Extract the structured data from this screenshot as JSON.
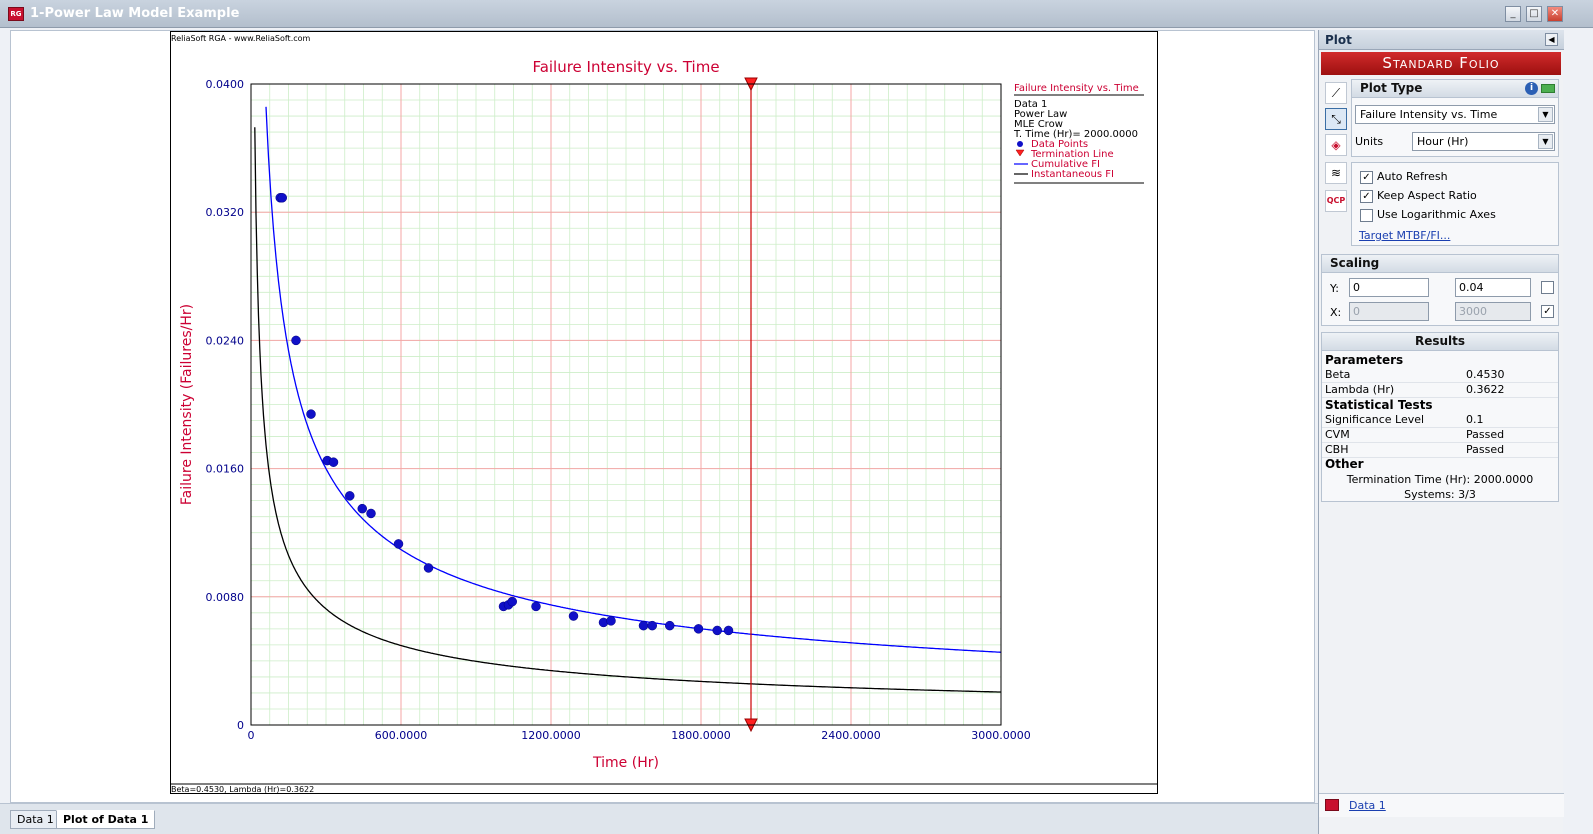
{
  "window": {
    "title": "1-Power Law Model Example"
  },
  "chart_header": "ReliaSoft RGA - www.ReliaSoft.com",
  "chart_footer": "Beta=0.4530, Lambda (Hr)=0.3622",
  "chart_data": {
    "type": "scatter",
    "title": "Failure Intensity vs. Time",
    "xlabel": "Time (Hr)",
    "ylabel": "Failure Intensity (Failures/Hr)",
    "xlim": [
      0,
      3000
    ],
    "ylim": [
      0,
      0.04
    ],
    "x_ticks": [
      "0",
      "600.0000",
      "1200.0000",
      "1800.0000",
      "2400.0000",
      "3000.0000"
    ],
    "y_ticks": [
      "0",
      "0.0080",
      "0.0160",
      "0.0240",
      "0.0320",
      "0.0400"
    ],
    "grid": true,
    "legend_position": "right",
    "termination_time": 2000,
    "beta": 0.453,
    "lambda": 0.3622,
    "data_points": {
      "x": [
        117,
        125,
        180,
        240,
        305,
        330,
        395,
        445,
        480,
        590,
        710,
        1010,
        1030,
        1045,
        1140,
        1290,
        1410,
        1440,
        1570,
        1605,
        1675,
        1790,
        1865,
        1910
      ],
      "y": [
        0.0329,
        0.0329,
        0.024,
        0.0194,
        0.0165,
        0.0164,
        0.0143,
        0.0135,
        0.0132,
        0.0113,
        0.0098,
        0.0074,
        0.0075,
        0.0077,
        0.0074,
        0.0068,
        0.0064,
        0.0065,
        0.0062,
        0.0062,
        0.0062,
        0.006,
        0.0059,
        0.0059
      ]
    },
    "legend": {
      "title": "Failure Intensity vs. Time",
      "info": [
        "Data 1",
        "Power Law",
        "MLE Crow",
        "T. Time (Hr)= 2000.0000"
      ],
      "entries": [
        "Data Points",
        "Termination Line",
        "Cumulative FI",
        "Instantaneous FI"
      ]
    }
  },
  "tabs": [
    "Data 1",
    "Plot of Data 1"
  ],
  "panel": {
    "header": "Plot",
    "folio": "Standard Folio",
    "plot_type": {
      "title": "Plot Type",
      "selected": "Failure Intensity vs. Time",
      "units_label": "Units",
      "units_value": "Hour (Hr)"
    },
    "options": {
      "auto_refresh": "Auto Refresh",
      "keep_aspect": "Keep Aspect Ratio",
      "log_axes": "Use Logarithmic Axes",
      "target_link": "Target MTBF/FI..."
    },
    "scaling": {
      "title": "Scaling",
      "y_label": "Y:",
      "x_label": "X:",
      "y_min": "0",
      "y_max": "0.04",
      "x_min": "0",
      "x_max": "3000"
    },
    "results": {
      "title": "Results",
      "parameters": "Parameters",
      "beta_label": "Beta",
      "beta": "0.4530",
      "lambda_label": "Lambda (Hr)",
      "lambda": "0.3622",
      "stat_tests": "Statistical Tests",
      "sig_label": "Significance Level",
      "sig": "0.1",
      "cvm_label": "CVM",
      "cvm": "Passed",
      "cbh_label": "CBH",
      "cbh": "Passed",
      "other": "Other",
      "term_time": "Termination Time (Hr): 2000.0000",
      "systems": "Systems: 3/3"
    },
    "bottom_link": "Data 1"
  },
  "colors": {
    "cumulative": "#0000ff",
    "instantaneous": "#000000",
    "points": "#1010c8",
    "termination": "#cc0000",
    "title": "#cc0033",
    "axis_text": "#00008b"
  }
}
